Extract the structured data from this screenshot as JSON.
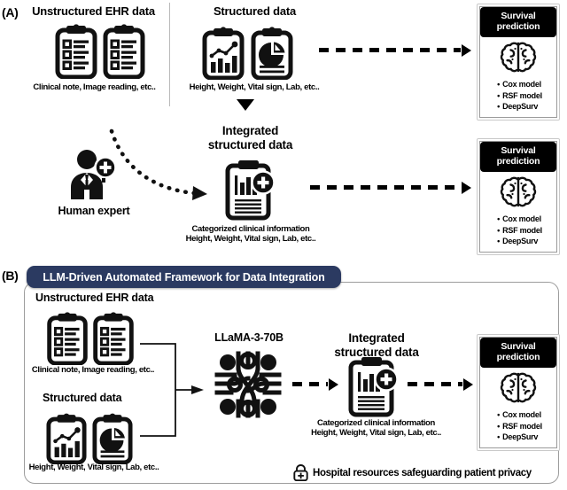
{
  "figure": {
    "panels": [
      {
        "id": "A",
        "label": "(A)"
      },
      {
        "id": "B",
        "label": "(B)"
      }
    ]
  },
  "panelA": {
    "label": "(A)",
    "unstructured": {
      "title": "Unstructured EHR data",
      "caption": "Clinical note, Image reading, etc..",
      "icon_1": "clipboard-checklist-icon",
      "icon_2": "clipboard-checklist-icon"
    },
    "structured": {
      "title": "Structured data",
      "caption": "Height, Weight, Vital sign, Lab, etc..",
      "icon_1": "clipboard-bar-chart-icon",
      "icon_2": "clipboard-pie-chart-icon"
    },
    "integrated": {
      "title_line1": "Integrated",
      "title_line2": "structured data",
      "caption_line1": "Categorized clinical information",
      "caption_line2": "Height, Weight, Vital sign, Lab, etc..",
      "icon": "clipboard-chart-plus-icon"
    },
    "human_expert": {
      "label": "Human expert",
      "icon": "doctor-person-icon"
    },
    "survival_top": {
      "header_line1": "Survival",
      "header_line2": "prediction",
      "icon": "brain-icon",
      "models": [
        "Cox model",
        "RSF model",
        "DeepSurv"
      ]
    },
    "survival_mid": {
      "header_line1": "Survival",
      "header_line2": "prediction",
      "icon": "brain-icon",
      "models": [
        "Cox model",
        "RSF model",
        "DeepSurv"
      ]
    }
  },
  "panelB": {
    "label": "(B)",
    "banner_title": "LLM-Driven Automated Framework for Data Integration",
    "banner_color": "#2b3a61",
    "unstructured": {
      "title": "Unstructured EHR data",
      "caption": "Clinical note, Image reading, etc..",
      "icon_1": "clipboard-checklist-icon",
      "icon_2": "clipboard-checklist-icon"
    },
    "structured": {
      "title": "Structured data",
      "caption": "Height, Weight, Vital sign, Lab, etc..",
      "icon_1": "clipboard-bar-chart-icon",
      "icon_2": "clipboard-pie-chart-icon"
    },
    "llm": {
      "label": "LLaMA-3-70B",
      "icon": "circuit-chip-icon"
    },
    "integrated": {
      "title_line1": "Integrated",
      "title_line2": "structured data",
      "caption_line1": "Categorized clinical information",
      "caption_line2": "Height, Weight, Vital sign, Lab, etc..",
      "icon": "clipboard-chart-plus-icon"
    },
    "survival": {
      "header_line1": "Survival",
      "header_line2": "prediction",
      "icon": "brain-icon",
      "models": [
        "Cox model",
        "RSF model",
        "DeepSurv"
      ]
    },
    "privacy": {
      "icon": "lock-plus-icon",
      "text": "Hospital resources safeguarding patient privacy"
    }
  }
}
